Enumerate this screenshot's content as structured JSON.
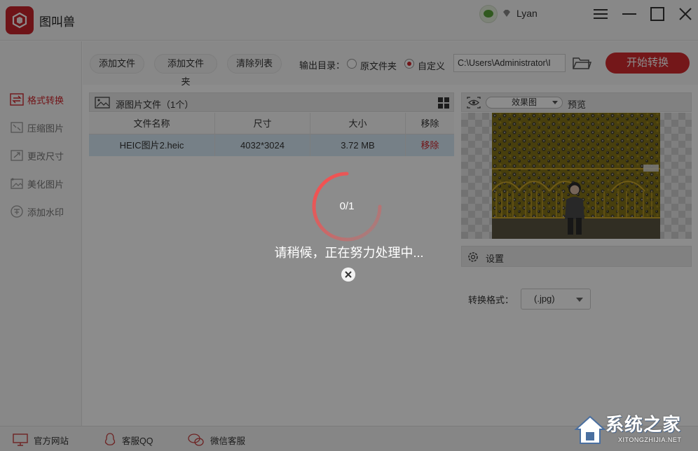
{
  "app": {
    "title": "图叫兽"
  },
  "user": {
    "name": "Lyan"
  },
  "sidebar": {
    "items": [
      {
        "label": "格式转换",
        "active": true
      },
      {
        "label": "压缩图片",
        "active": false
      },
      {
        "label": "更改尺寸",
        "active": false
      },
      {
        "label": "美化图片",
        "active": false
      },
      {
        "label": "添加水印",
        "active": false
      }
    ]
  },
  "toolbar": {
    "add_file": "添加文件",
    "add_folder": "添加文件夹",
    "clear_list": "清除列表",
    "output_label": "输出目录：",
    "radio_original": "原文件夹",
    "radio_custom": "自定义",
    "selected_output": "自定义",
    "path_value": "C:\\Users\\Administrator\\I",
    "start_button": "开始转换"
  },
  "file_panel": {
    "title": "源图片文件（1个）",
    "columns": [
      "文件名称",
      "尺寸",
      "大小",
      "移除"
    ],
    "rows": [
      {
        "name": "HEIC图片2.heic",
        "dimensions": "4032*3024",
        "size": "3.72 MB",
        "action": "移除"
      }
    ]
  },
  "preview": {
    "mode_select": "效果图",
    "label": "预览"
  },
  "settings": {
    "title": "设置",
    "format_label": "转换格式：",
    "format_value": "(.jpg)"
  },
  "footer": {
    "website": "官方网站",
    "qq": "客服QQ",
    "wechat": "微信客服"
  },
  "modal": {
    "progress": "0/1",
    "message": "请稍候，正在努力处理中..."
  },
  "watermark": {
    "brand": "系统之家",
    "url": "XITONGZHIJIA.NET"
  },
  "colors": {
    "accent": "#d0272d",
    "selected_row": "#d8eaf6",
    "overlay": "rgba(0,0,0,0.45)"
  }
}
